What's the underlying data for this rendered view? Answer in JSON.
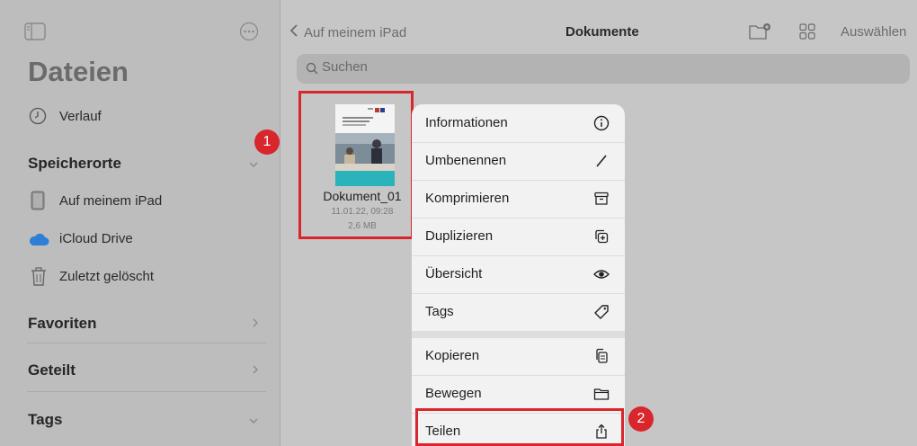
{
  "sidebar": {
    "title": "Dateien",
    "recents": {
      "label": "Verlauf",
      "icon": "clock-icon"
    },
    "locations": {
      "header": "Speicherorte",
      "items": [
        {
          "label": "Auf meinem iPad",
          "icon": "ipad-icon"
        },
        {
          "label": "iCloud Drive",
          "icon": "cloud-icon"
        },
        {
          "label": "Zuletzt gelöscht",
          "icon": "trash-icon"
        }
      ]
    },
    "favorites": {
      "header": "Favoriten"
    },
    "shared": {
      "header": "Geteilt"
    },
    "tags": {
      "header": "Tags"
    }
  },
  "main": {
    "back_label": "Auf meinem iPad",
    "title": "Dokumente",
    "select_label": "Auswählen",
    "search_placeholder": "Suchen"
  },
  "file": {
    "name": "Dokument_01",
    "date": "11.01.22, 09:28",
    "size": "2,6 MB"
  },
  "context_menu": {
    "items": [
      {
        "label": "Informationen",
        "icon": "info-icon"
      },
      {
        "label": "Umbenennen",
        "icon": "pencil-icon"
      },
      {
        "label": "Komprimieren",
        "icon": "archive-box-icon"
      },
      {
        "label": "Duplizieren",
        "icon": "duplicate-icon"
      },
      {
        "label": "Übersicht",
        "icon": "eye-icon"
      },
      {
        "label": "Tags",
        "icon": "tag-icon"
      },
      {
        "label": "Kopieren",
        "icon": "copy-icon"
      },
      {
        "label": "Bewegen",
        "icon": "folder-icon"
      },
      {
        "label": "Teilen",
        "icon": "share-icon"
      }
    ]
  },
  "annotations": {
    "badge1": "1",
    "badge2": "2",
    "highlight_color": "#d9262c"
  }
}
